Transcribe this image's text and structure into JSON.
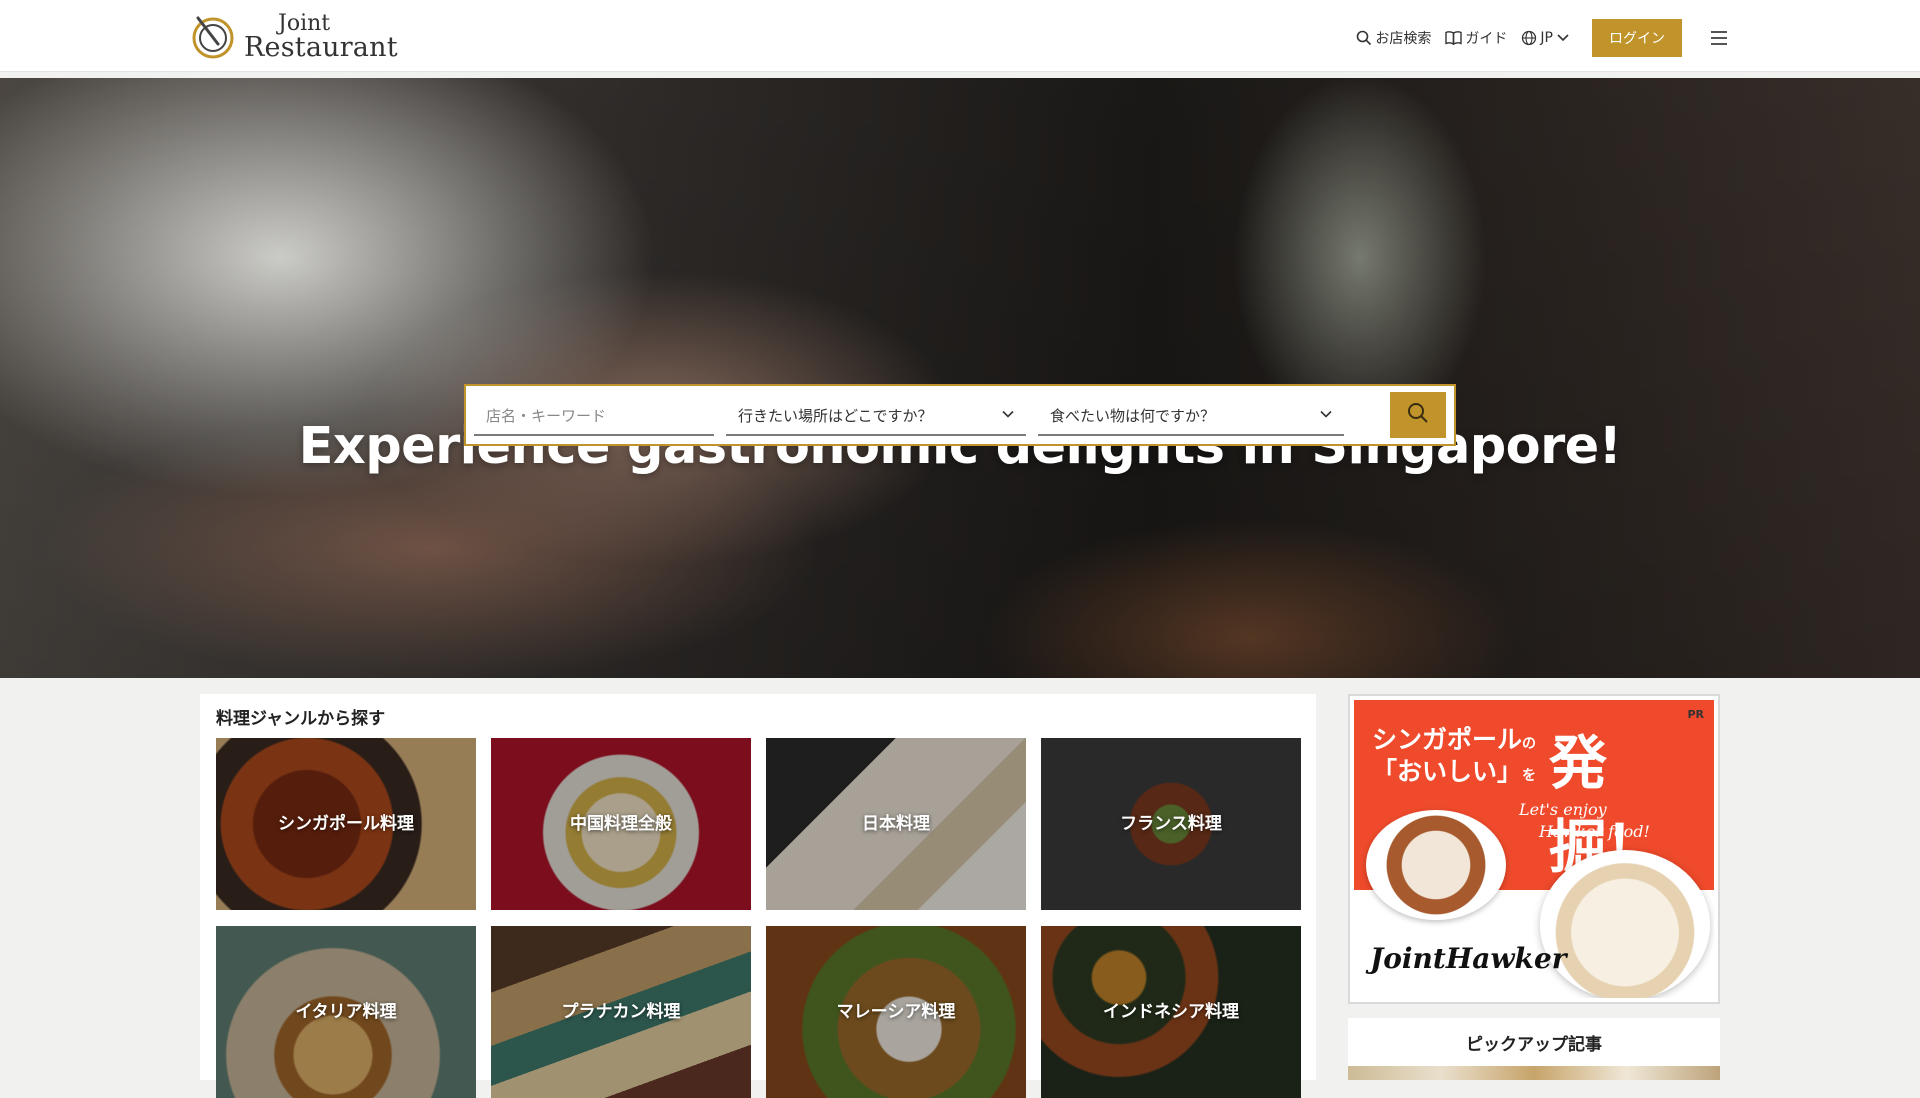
{
  "brand": {
    "logo_line1": "Joint",
    "logo_line2": "Restaurant"
  },
  "nav": {
    "search_label": "お店検索",
    "guide_label": "ガイド",
    "lang_label": "JP",
    "login_label": "ログイン"
  },
  "hero": {
    "title": "Experience gastronomic delights in Singapore!",
    "search": {
      "keyword_placeholder": "店名・キーワード",
      "location_label": "行きたい場所はどこですか？",
      "food_label": "食べたい物は何ですか？"
    }
  },
  "genres": {
    "title": "料理ジャンルから探す",
    "items": [
      {
        "label": "シンガポール料理"
      },
      {
        "label": "中国料理全般"
      },
      {
        "label": "日本料理"
      },
      {
        "label": "フランス料理"
      },
      {
        "label": "イタリア料理"
      },
      {
        "label": "プラナカン料理"
      },
      {
        "label": "マレーシア料理"
      },
      {
        "label": "インドネシア料理"
      }
    ]
  },
  "ad": {
    "pr": "PR",
    "line1": "シンガポール",
    "line1_particle": "の",
    "line2": "「おいしい」",
    "line2_particle": "を",
    "big": "発掘！",
    "script1": "Let's enjoy",
    "script2": "Hawker food!",
    "brand": "JointHawker"
  },
  "pickup": {
    "title": "ピックアップ記事"
  },
  "colors": {
    "accent": "#c0942b",
    "ad_red": "#ef4a2b"
  }
}
